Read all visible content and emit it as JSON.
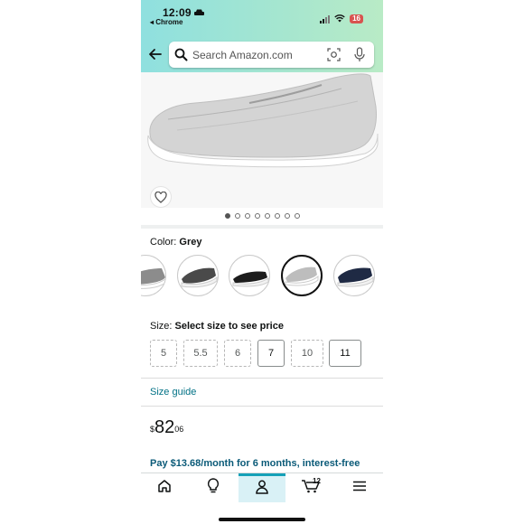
{
  "status_bar": {
    "time": "12:09",
    "back_app": "◂ Chrome",
    "battery": "16"
  },
  "search": {
    "placeholder": "Search Amazon.com"
  },
  "gallery": {
    "dot_count": 8,
    "active_index": 0
  },
  "color": {
    "label": "Color: ",
    "value": "Grey"
  },
  "size": {
    "label": "Size: ",
    "value": "Select size to see price",
    "options": [
      {
        "label": "5",
        "available": false
      },
      {
        "label": "5.5",
        "available": false
      },
      {
        "label": "6",
        "available": false
      },
      {
        "label": "7",
        "available": true
      },
      {
        "label": "10",
        "available": false
      },
      {
        "label": "11",
        "available": true
      }
    ]
  },
  "size_guide": "Size guide",
  "price": {
    "currency": "$",
    "whole": "82",
    "fraction": "06"
  },
  "promo": {
    "prefix": "Pay ",
    "amount": "$13.68/month for 6 months",
    "suffix": ", interest-free upon"
  },
  "nav": {
    "cart_count": "12"
  },
  "colors": {
    "accent": "#15a1b8",
    "link": "#007185"
  }
}
